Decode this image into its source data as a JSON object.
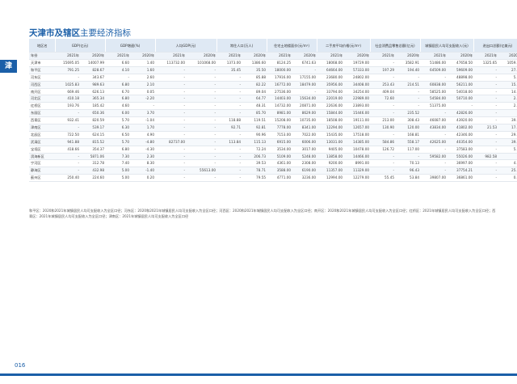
{
  "side_tab": "津",
  "title": {
    "main": "天津市及辖区",
    "sub": "主要经济指标"
  },
  "columns": [
    {
      "label": "地区名",
      "years": [
        "年份"
      ]
    },
    {
      "label": "GDP(亿元)",
      "years": [
        "2021年",
        "2020年"
      ]
    },
    {
      "label": "GDP增速(%)",
      "years": [
        "2021年",
        "2020年"
      ]
    },
    {
      "label": "人均GDP(元)",
      "years": [
        "2021年",
        "2020年"
      ]
    },
    {
      "label": "常住人口(万人)",
      "years": [
        "2021年",
        "2020年"
      ]
    },
    {
      "label": "住宅土地楼面价(元/m²)",
      "years": [
        "2021年",
        "2020年"
      ]
    },
    {
      "label": "二手房平均价格(元/m²)",
      "years": [
        "2021年",
        "2020年"
      ]
    },
    {
      "label": "社会消费品零售总额(亿元)",
      "years": [
        "2021年",
        "2020年"
      ]
    },
    {
      "label": "城镇居民人均可支配收入(元)",
      "years": [
        "2021年",
        "2020年"
      ]
    },
    {
      "label": "进出口总额(亿美元)",
      "years": [
        "2021年",
        "2020年"
      ]
    }
  ],
  "rows": [
    {
      "name": "天津市",
      "values": [
        "15695.05",
        "14007.99",
        "6.60",
        "1.40",
        "113732.00",
        "101068.00",
        "1373.00",
        "1386.60",
        "8124.25",
        "6741.63",
        "18068.00",
        "19729.00",
        "-",
        "3582.91",
        "51486.00",
        "47658.50",
        "1325.65",
        "1059.31"
      ]
    },
    {
      "name": "和平区",
      "values": [
        "791.25",
        "828.67",
        "4.10",
        "1.60",
        "-",
        "-",
        "35.45",
        "35.50",
        "18000.00",
        "-",
        "64664.00",
        "57333.00",
        "197.29",
        "194.40",
        "64509.00",
        "59609.00",
        "-",
        "27.01"
      ]
    },
    {
      "name": "河东区",
      "values": [
        "-",
        "343.67",
        "-",
        "2.60",
        "-",
        "-",
        "-",
        "85.88",
        "17916.00",
        "17155.00",
        "23680.00",
        "24802.00",
        "-",
        "-",
        "-",
        "48898.00",
        "-",
        "5.36"
      ]
    },
    {
      "name": "河西区",
      "values": [
        "1025.83",
        "989.63",
        "6.80",
        "2.10",
        "-",
        "-",
        "-",
        "82.22",
        "16772.00",
        "18479.00",
        "35956.00",
        "34408.00",
        "253.43",
        "214.51",
        "60838.00",
        "56211.00",
        "-",
        "15.89"
      ]
    },
    {
      "name": "南开区",
      "values": [
        "669.46",
        "626.13",
        "6.70",
        "0.05",
        "-",
        "-",
        "-",
        "89.04",
        "27536.00",
        "-",
        "33794.00",
        "34254.00",
        "409.04",
        "-",
        "58525.00",
        "54018.00",
        "-",
        "14.03"
      ]
    },
    {
      "name": "河北区",
      "values": [
        "410.18",
        "365.34",
        "6.80",
        "-2.20",
        "-",
        "-",
        "-",
        "64.77",
        "14403.00",
        "15634.00",
        "22019.00",
        "22989.00",
        "72.60",
        "-",
        "54584.00",
        "50710.00",
        "-",
        "2.58"
      ]
    },
    {
      "name": "红桥区",
      "values": [
        "193.76",
        "185.42",
        "4.60",
        "-",
        "-",
        "-",
        "-",
        "48.31",
        "14732.00",
        "20871.00",
        "22636.00",
        "23893.00",
        "-",
        "-",
        "51375.00",
        "-",
        "-",
        "2.74"
      ]
    },
    {
      "name": "东丽区",
      "values": [
        "-",
        "650.36",
        "6.00",
        "3.70",
        "-",
        "-",
        "-",
        "85.70",
        "8981.00",
        "8629.00",
        "15844.00",
        "15446.00",
        "-",
        "235.52",
        "-",
        "42826.00",
        "-",
        "-"
      ]
    },
    {
      "name": "西青区",
      "values": [
        "932.41",
        "820.59",
        "5.70",
        "-1.04",
        "-",
        "-",
        "118.88",
        "119.51",
        "15208.00",
        "10735.00",
        "18508.00",
        "19111.00",
        "213.00",
        "308.43",
        "46087.00",
        "43920.00",
        "-",
        "39.17"
      ]
    },
    {
      "name": "津南区",
      "values": [
        "-",
        "539.17",
        "6.30",
        "1.70",
        "-",
        "-",
        "92.71",
        "92.81",
        "7778.00",
        "8341.00",
        "12294.00",
        "12657.00",
        "130.90",
        "120.00",
        "43834.00",
        "41802.00",
        "21.53",
        "17.93"
      ]
    },
    {
      "name": "北辰区",
      "values": [
        "722.50",
        "624.15",
        "6.50",
        "4.90",
        "-",
        "-",
        "-",
        "90.96",
        "7153.00",
        "7022.00",
        "15435.00",
        "17518.00",
        "-",
        "168.81",
        "-",
        "42346.00",
        "-",
        "29.61"
      ]
    },
    {
      "name": "武清区",
      "values": [
        "941.88",
        "815.52",
        "5.70",
        "-4.80",
        "82737.00",
        "-",
        "113.84",
        "115.13",
        "6915.00",
        "6006.00",
        "13031.00",
        "14385.00",
        "584.86",
        "558.17",
        "42625.00",
        "40354.00",
        "-",
        "39.93"
      ]
    },
    {
      "name": "宝坻区",
      "values": [
        "418.66",
        "354.37",
        "6.80",
        "-4.30",
        "-",
        "-",
        "-",
        "72.24",
        "3534.00",
        "3017.00",
        "9405.00",
        "10478.00",
        "126.72",
        "117.00",
        "-",
        "37583.00",
        "-",
        "5.97"
      ]
    },
    {
      "name": "滨海新区",
      "values": [
        "-",
        "5871.06",
        "7.30",
        "2.30",
        "-",
        "-",
        "-",
        "206.73",
        "5109.00",
        "5248.00",
        "13858.00",
        "14466.00",
        "-",
        "-",
        "59582.00",
        "55026.00",
        "982.58",
        "-"
      ]
    },
    {
      "name": "宁河区",
      "values": [
        "-",
        "312.78",
        "7.40",
        "8.30",
        "-",
        "-",
        "-",
        "39.53",
        "4361.00",
        "2308.00",
        "9200.00",
        "8991.00",
        "-",
        "70.13",
        "-",
        "36997.00",
        "-",
        "4.38"
      ]
    },
    {
      "name": "静海区",
      "values": [
        "-",
        "432.98",
        "5.00",
        "-1.40",
        "-",
        "55613.00",
        "-",
        "78.71",
        "3588.00",
        "6190.00",
        "11357.00",
        "11329.00",
        "-",
        "96.43",
        "-",
        "37754.21",
        "-",
        "25.24"
      ]
    },
    {
      "name": "蓟州区",
      "values": [
        "250.40",
        "224.60",
        "5.00",
        "0.20",
        "-",
        "-",
        "-",
        "79.55",
        "4771.00",
        "3236.00",
        "12994.00",
        "12279.00",
        "55.45",
        "53.84",
        "39807.00",
        "36861.00",
        "-",
        "0.54"
      ]
    }
  ],
  "notes": "和平区：2020和2021年城镇居民人均可支配收入为全区口径；河东区：2020和2021年城镇居民人均可支配收入为全区口径；河西区：2020和2021年城镇居民人均可支配收入为全区口径；南开区：2020和2021年城镇居民人均可支配收入为全区口径；红桥区：2021年城镇居民人均可支配收入为全区口径；西青区：2021年城镇居民人均可支配收入为全区口径；津南区：2021年城镇居民人均可支配收入为全区口径",
  "page_number": "016",
  "colors": {
    "accent": "#1b5fa8",
    "header_bg": "#dfe9f4"
  }
}
